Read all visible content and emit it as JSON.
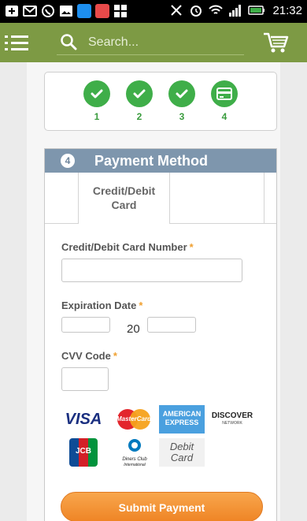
{
  "status_bar": {
    "time": "21:32",
    "icons": [
      "plus-icon",
      "email-icon",
      "whatsapp-icon",
      "gallery-icon",
      "zalo-icon",
      "app-icon",
      "grid-app-icon",
      "mute-icon",
      "alarm-icon",
      "wifi-icon",
      "signal-icon",
      "battery-icon"
    ]
  },
  "header": {
    "search_placeholder": "Search...",
    "brand_color": "#7d9a44"
  },
  "stepper": {
    "steps": [
      {
        "number": "1",
        "state": "complete",
        "icon": "check-icon"
      },
      {
        "number": "2",
        "state": "complete",
        "icon": "check-icon"
      },
      {
        "number": "3",
        "state": "complete",
        "icon": "check-icon"
      },
      {
        "number": "4",
        "state": "current",
        "icon": "credit-card-icon"
      }
    ],
    "active_color": "#3fae49"
  },
  "payment": {
    "step_number": "4",
    "title": "Payment Method",
    "tab_label": "Credit/Debit Card",
    "fields": {
      "card_number_label": "Credit/Debit Card Number",
      "expiration_label": "Expiration Date",
      "expiration_year_prefix": "20",
      "cvv_label": "CVV Code",
      "required_mark": "*"
    },
    "card_logos": {
      "visa": "VISA",
      "mastercard": "MasterCard",
      "amex_line1": "AMERICAN",
      "amex_line2": "EXPRESS",
      "discover": "DISCOVER",
      "discover_sub": "NETWORK",
      "jcb": "JCB",
      "diners_line1": "Diners Club",
      "diners_line2": "International",
      "debit_line1": "Debit",
      "debit_line2": "Card"
    },
    "submit_label": "Submit Payment",
    "header_color": "#7e96ad",
    "button_color": "#f39335"
  }
}
